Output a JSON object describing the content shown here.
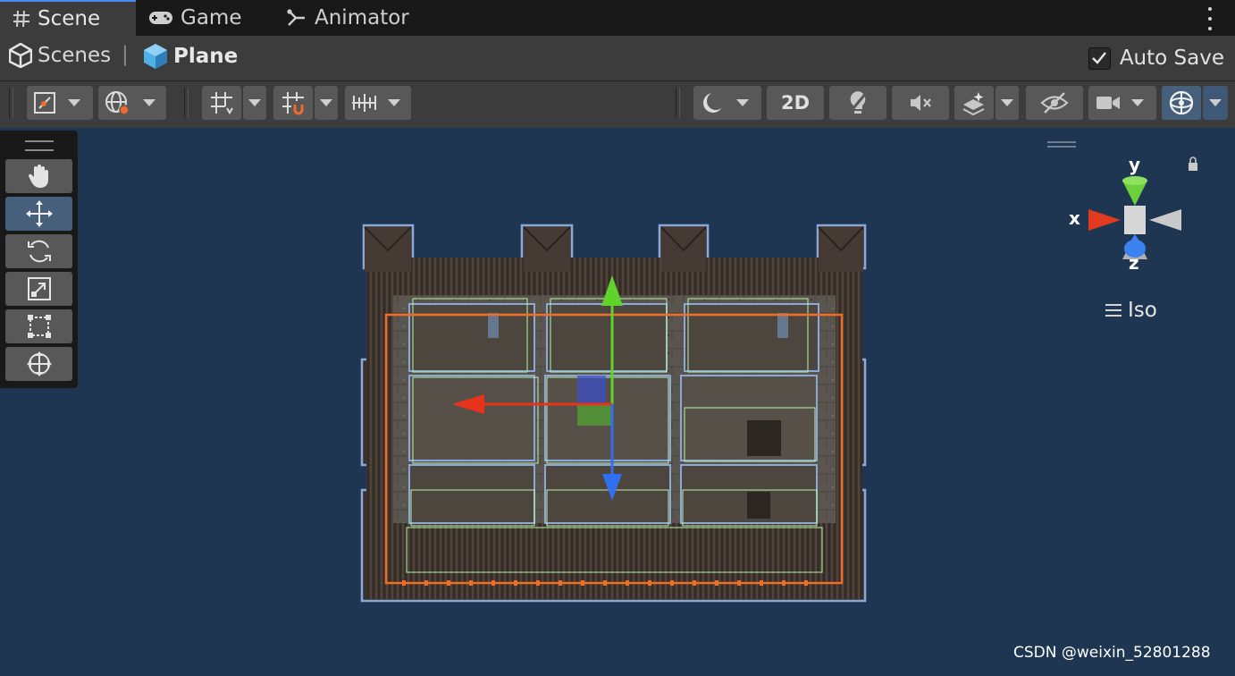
{
  "tabs": [
    {
      "label": "Scene",
      "icon": "hash-icon",
      "active": true
    },
    {
      "label": "Game",
      "icon": "gamepad-icon",
      "active": false
    },
    {
      "label": "Animator",
      "icon": "animator-icon",
      "active": false
    }
  ],
  "breadcrumb": {
    "root": "Scenes",
    "separator": "|",
    "current": "Plane"
  },
  "auto_save": {
    "label": "Auto Save",
    "checked": true
  },
  "toolbar": {
    "two_d_label": "2D",
    "buttons": [
      "tool-handle-position-icon",
      "pivot-global-icon",
      "grid-snap-icon",
      "increment-snap-icon",
      "ruler-icon",
      "shading-mode-icon",
      "2d-toggle",
      "lighting-toggle-icon",
      "audio-mute-icon",
      "effects-icon",
      "scene-visibility-icon",
      "camera-icon",
      "gizmos-icon"
    ]
  },
  "tools": [
    "hand-tool-icon",
    "move-tool-icon",
    "rotate-tool-icon",
    "scale-tool-icon",
    "rect-tool-icon",
    "transform-tool-icon"
  ],
  "active_tool": "move",
  "orientation_gizmo": {
    "x_label": "x",
    "y_label": "y",
    "z_label": "z",
    "projection": "Iso"
  },
  "watermark": "CSDN @weixin_52801288",
  "colors": {
    "viewport": "#1f3652",
    "panel": "#3c3c3c",
    "tab_bar": "#191919",
    "selected_button": "#46607c",
    "x_axis": "#e8331c",
    "y_axis": "#5fd329",
    "z_axis": "#2f6ff0",
    "selection_outline": "#ef6d24"
  }
}
